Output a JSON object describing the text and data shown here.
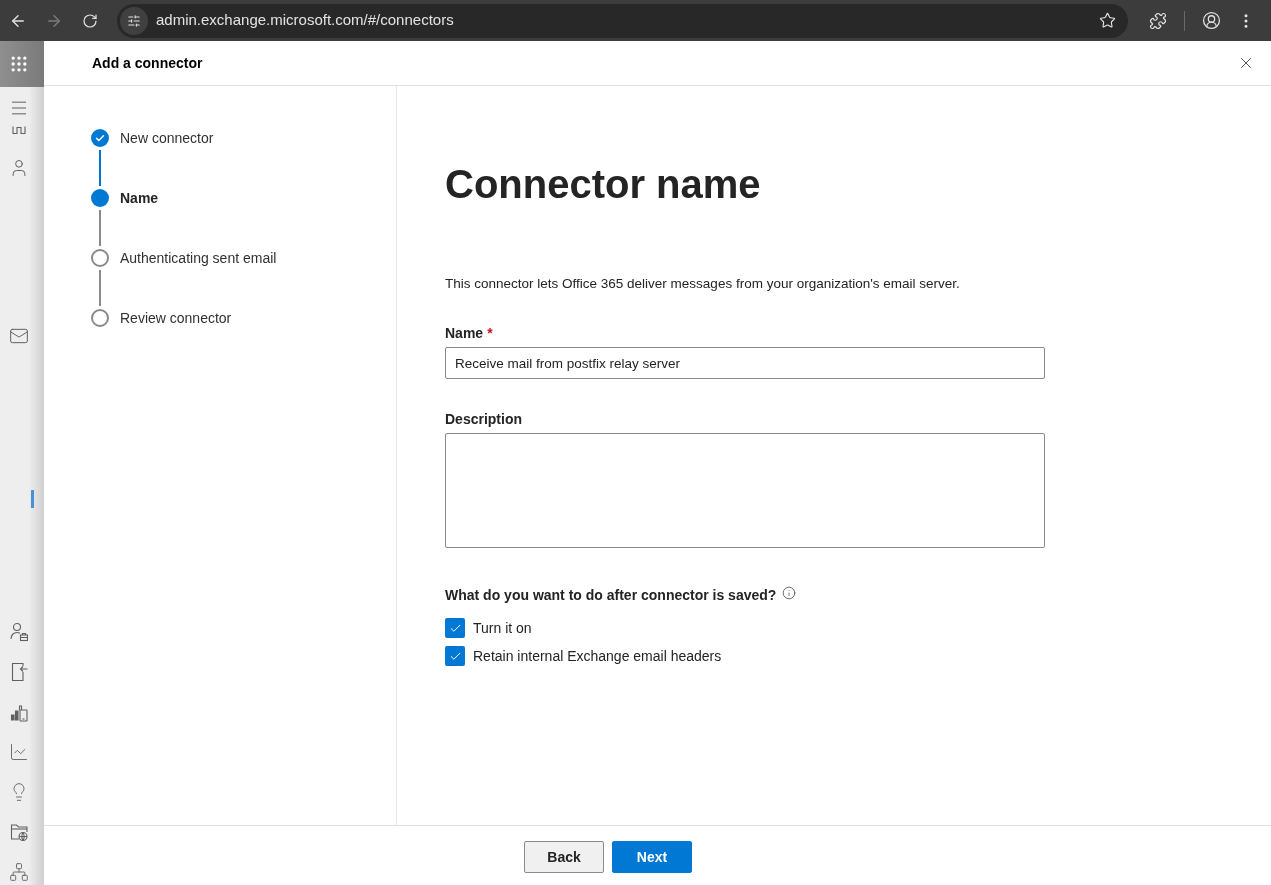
{
  "browser": {
    "url": "admin.exchange.microsoft.com/#/connectors",
    "forward_disabled": true
  },
  "panel": {
    "title": "Add a connector"
  },
  "steps": [
    {
      "label": "New connector",
      "completed": true,
      "selected": false
    },
    {
      "label": "Name",
      "completed": false,
      "selected": true
    },
    {
      "label": "Authenticating sent email",
      "completed": false,
      "selected": false
    },
    {
      "label": "Review connector",
      "completed": false,
      "selected": false
    }
  ],
  "form": {
    "heading": "Connector name",
    "intro": "This connector lets Office 365 deliver messages from your organization's email server.",
    "fields": [
      {
        "kind": "input",
        "label": "Name",
        "required_mark": "*",
        "value": "Receive mail from postfix relay server"
      },
      {
        "kind": "textarea",
        "label": "Description"
      }
    ],
    "after_save": {
      "question": "What do you want to do after connector is saved?",
      "options": [
        {
          "label": "Turn it on",
          "checked": true
        },
        {
          "label": "Retain internal Exchange email headers",
          "checked": true
        }
      ]
    }
  },
  "footer": {
    "buttons": [
      {
        "label": "Back",
        "kind": "secondary"
      },
      {
        "label": "Next",
        "kind": "primary"
      }
    ]
  }
}
